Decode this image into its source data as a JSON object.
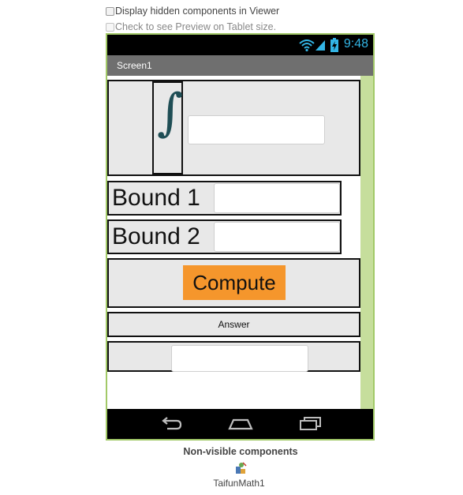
{
  "options": {
    "display_hidden": "Display hidden components in Viewer",
    "tablet_preview": "Check to see Preview on Tablet size."
  },
  "status_bar": {
    "time": "9:48"
  },
  "screen": {
    "title": "Screen1"
  },
  "integral_row": {
    "symbol": "∫",
    "input_value": ""
  },
  "bound1": {
    "label": "Bound 1",
    "input_value": ""
  },
  "bound2": {
    "label": "Bound 2",
    "input_value": ""
  },
  "compute": {
    "label": "Compute"
  },
  "answer": {
    "label": "Answer"
  },
  "result": {
    "input_value": ""
  },
  "nonvisible": {
    "title": "Non-visible components",
    "items": [
      {
        "label": "TaifunMath1"
      }
    ]
  },
  "colors": {
    "accent_clock": "#33b5e5",
    "button_orange": "#f5962c",
    "phone_border": "#a2c968",
    "title_bar": "#6f6f6f"
  }
}
